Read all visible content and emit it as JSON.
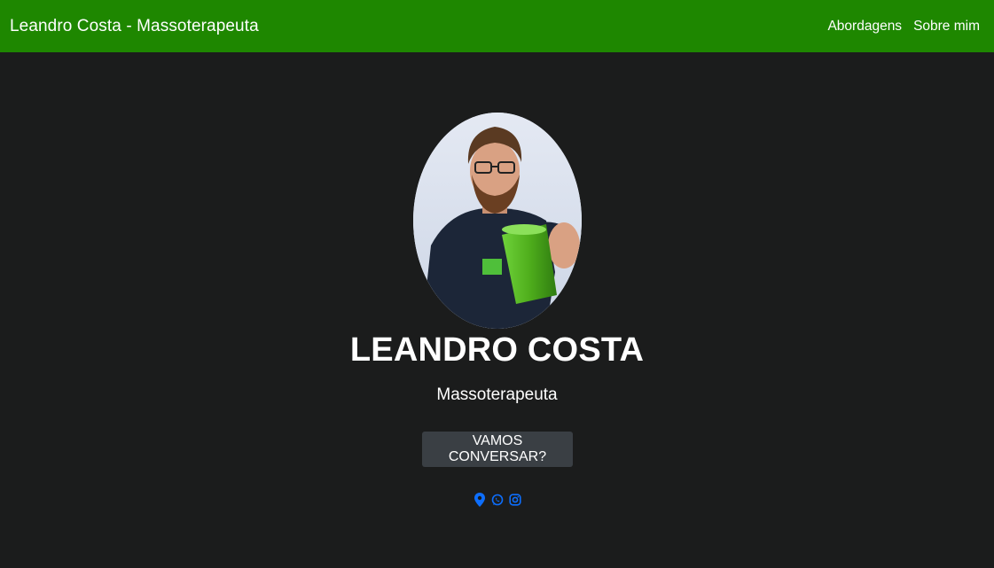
{
  "navbar": {
    "brand": "Leandro Costa - Massoterapeuta",
    "links": [
      {
        "label": "Abordagens"
      },
      {
        "label": "Sobre mim"
      }
    ],
    "color": "#1e8700"
  },
  "hero": {
    "name": "LEANDRO COSTA",
    "subtitle": "Massoterapeuta",
    "cta_label": "VAMOS CONVERSAR?",
    "background": "#1b1c1c"
  },
  "social": {
    "icons": [
      "location-pin-icon",
      "whatsapp-icon",
      "instagram-icon"
    ],
    "color": "#0d6efd"
  }
}
